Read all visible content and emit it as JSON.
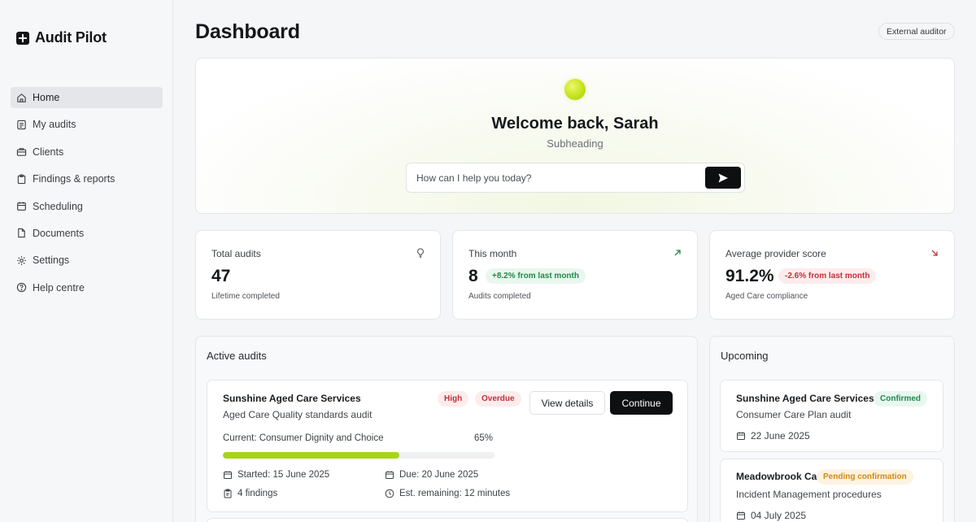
{
  "app": {
    "name": "Audit Pilot"
  },
  "sidebar": {
    "items": [
      {
        "label": "Home",
        "icon": "home-icon",
        "active": true
      },
      {
        "label": "My audits",
        "icon": "audit-list-icon"
      },
      {
        "label": "Clients",
        "icon": "clients-icon"
      },
      {
        "label": "Findings & reports",
        "icon": "clipboard-icon"
      },
      {
        "label": "Scheduling",
        "icon": "calendar-icon"
      },
      {
        "label": "Documents",
        "icon": "document-icon"
      },
      {
        "label": "Settings",
        "icon": "gear-icon"
      },
      {
        "label": "Help centre",
        "icon": "help-icon"
      }
    ]
  },
  "header": {
    "title": "Dashboard",
    "role_badge": "External auditor"
  },
  "hero": {
    "title": "Welcome back, Sarah",
    "subheading": "Subheading",
    "prompt_placeholder": "How can I help you today?"
  },
  "stats": [
    {
      "label": "Total audits",
      "value": "47",
      "footnote": "Lifetime completed",
      "icon": "lightbulb-icon"
    },
    {
      "label": "This month",
      "value": "8",
      "change": "+8.2% from last month",
      "trend": "up",
      "footnote": "Audits completed",
      "icon": "trend-up-arrow-icon"
    },
    {
      "label": "Average provider score",
      "value": "91.2%",
      "change": "-2.6% from last month",
      "trend": "down",
      "footnote": "Aged Care compliance",
      "icon": "trend-down-arrow-icon"
    }
  ],
  "active_audits": {
    "title": "Active audits",
    "items": [
      {
        "provider": "Sunshine Aged Care Services",
        "description": "Aged Care Quality standards audit",
        "priority": "High",
        "status": "Overdue",
        "view_label": "View details",
        "continue_label": "Continue",
        "current_step": "Current: Consumer Dignity and Choice",
        "progress_pct_label": "65%",
        "progress": 0.65,
        "started": "Started: 15 June 2025",
        "due": "Due: 20 June 2025",
        "findings": "4 findings",
        "remaining": "Est. remaining: 12 minutes"
      }
    ]
  },
  "upcoming": {
    "title": "Upcoming",
    "items": [
      {
        "provider": "Sunshine Aged Care Services",
        "status": "Confirmed",
        "description": "Consumer Care Plan audit",
        "date": "22 June 2025"
      },
      {
        "provider": "Meadowbrook Care",
        "status": "Pending confirmation",
        "description": "Incident Management procedures",
        "date": "04 July 2025"
      }
    ]
  },
  "colors": {
    "accent": "#a8d418",
    "positive": "#1f8a4c",
    "negative": "#c2303b",
    "pending": "#d48a12",
    "primary_button": "#0d0f11"
  }
}
